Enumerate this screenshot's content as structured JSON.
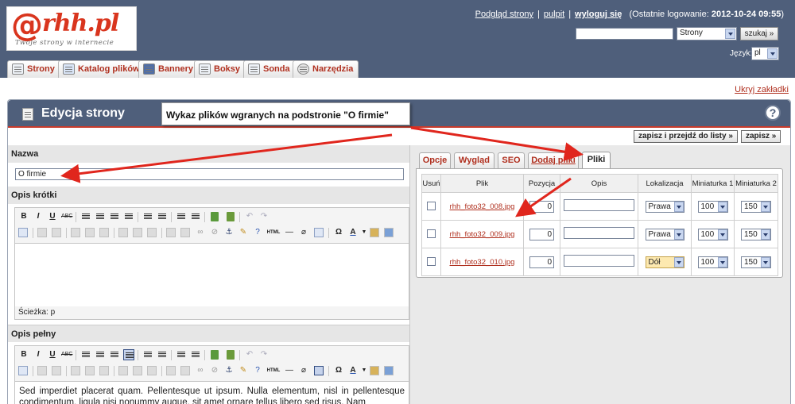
{
  "logo": {
    "mark": "@",
    "name": "rhh.pl",
    "tagline": "Twoje strony w internecie"
  },
  "header": {
    "preview_link": "Podgląd strony",
    "sep1": "|",
    "panel_link": "pulpit",
    "sep2": "|",
    "logout_link": "wyloguj się",
    "last_login_prefix": "(Ostatnie logowanie: ",
    "last_login_value": "2012-10-24 09:55",
    "last_login_suffix": ")",
    "search_value": "",
    "search_scope": "Strony",
    "search_button": "szukaj »",
    "lang_label": "Język:",
    "lang_value": "pl"
  },
  "nav": {
    "tabs": [
      {
        "label": "Strony",
        "icon": "pages-icon"
      },
      {
        "label": "Katalog plików",
        "icon": "folder-icon"
      },
      {
        "label": "Bannery",
        "icon": "banner-icon"
      },
      {
        "label": "Boksy",
        "icon": "boxes-icon"
      },
      {
        "label": "Sonda",
        "icon": "poll-icon"
      },
      {
        "label": "Narzędzia",
        "icon": "gear-icon"
      }
    ],
    "hide_tabs": "Ukryj zakładki"
  },
  "panel": {
    "title": "Edycja strony",
    "help": "?",
    "save_and_list": "zapisz i przejdź do listy »",
    "save": "zapisz »"
  },
  "callout": "Wykaz plików wgranych na podstronie \"O firmie\"",
  "form": {
    "name_label": "Nazwa",
    "name_value": "O firmie",
    "short_desc_label": "Opis krótki",
    "path_label": "Ścieżka: p",
    "full_desc_label": "Opis pełny",
    "full_desc_text": "Sed imperdiet placerat quam. Pellentesque ut ipsum. Nulla elementum, nisl in pellentesque condimentum, ligula nisi nonummy augue, sit amet ornare tellus libero sed risus. Nam"
  },
  "right_tabs": [
    "Opcje",
    "Wygląd",
    "SEO",
    "Dodaj pliki",
    "Pliki"
  ],
  "files_table": {
    "headers": [
      "Usuń",
      "Plik",
      "Pozycja",
      "Opis",
      "Lokalizacja",
      "Miniaturka 1",
      "Miniaturka 2"
    ],
    "rows": [
      {
        "file": "rhh_foto32_008.jpg",
        "position": "0",
        "desc": "",
        "location": "Prawa",
        "thumb1": "100",
        "thumb2": "150"
      },
      {
        "file": "rhh_foto32_009.jpg",
        "position": "0",
        "desc": "",
        "location": "Prawa",
        "thumb1": "100",
        "thumb2": "150"
      },
      {
        "file": "rhh_foto32_010.jpg",
        "position": "0",
        "desc": "",
        "location": "Dół",
        "thumb1": "100",
        "thumb2": "150"
      }
    ]
  },
  "toolbar": {
    "bold": "B",
    "italic": "I",
    "underline": "U",
    "strike": "ABC",
    "omega": "Ω",
    "font_color": "A",
    "html": "HTML"
  },
  "colors": {
    "header_bg": "#4f5f7b",
    "accent_red": "#b0301f",
    "arrow_red": "#e0261d"
  }
}
